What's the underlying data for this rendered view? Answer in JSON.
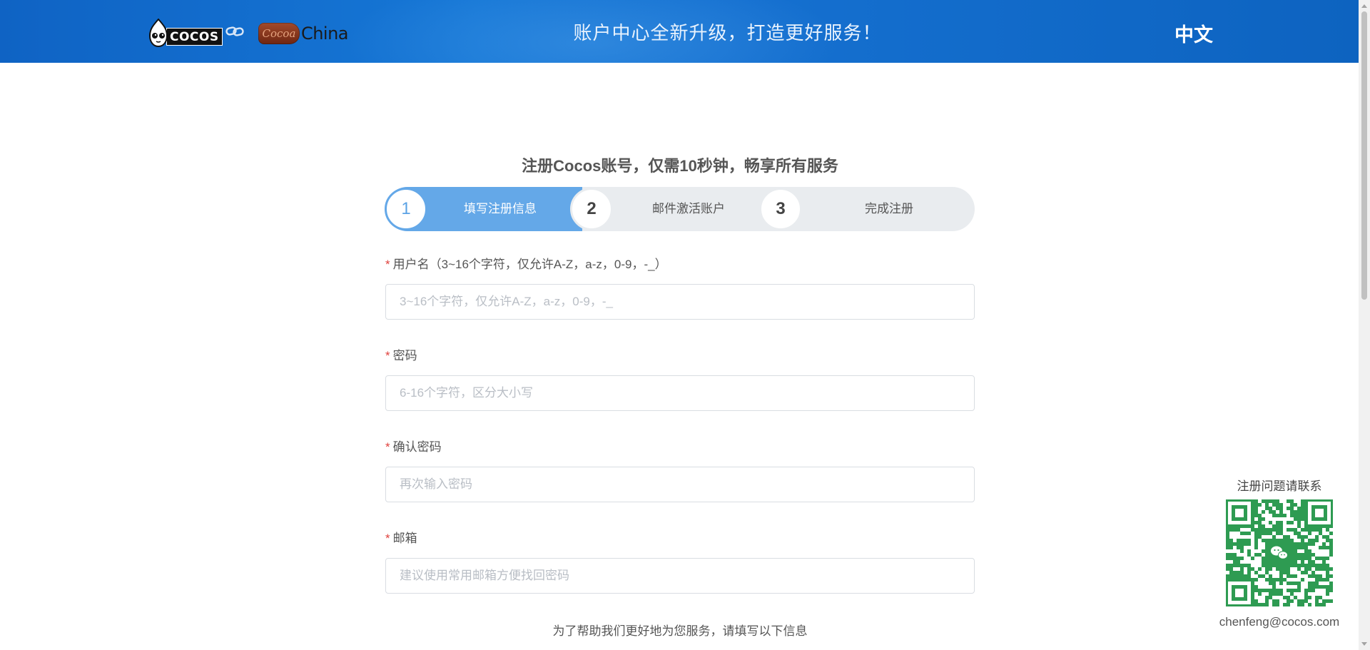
{
  "header": {
    "logo_cocos_text": "COCOS",
    "logo_cocoa_badge": "Cocoa",
    "logo_china_text": "China",
    "slogan": "账户中心全新升级，打造更好服务！",
    "language": "中文"
  },
  "page": {
    "title": "注册Cocos账号，仅需10秒钟，畅享所有服务"
  },
  "steps": [
    {
      "number": "1",
      "label": "填写注册信息",
      "active": true
    },
    {
      "number": "2",
      "label": "邮件激活账户",
      "active": false
    },
    {
      "number": "3",
      "label": "完成注册",
      "active": false
    }
  ],
  "form": {
    "required_mark": "*",
    "username": {
      "label": "用户名（3~16个字符，仅允许A-Z，a-z，0-9，-_）",
      "placeholder": "3~16个字符，仅允许A-Z，a-z，0-9，-_",
      "value": ""
    },
    "password": {
      "label": "密码",
      "placeholder": "6-16个字符，区分大小写",
      "value": ""
    },
    "confirm_password": {
      "label": "确认密码",
      "placeholder": "再次输入密码",
      "value": ""
    },
    "email": {
      "label": "邮箱",
      "placeholder": "建议使用常用邮箱方便找回密码",
      "value": ""
    },
    "help_text": "为了帮助我们更好地为您服务，请填写以下信息"
  },
  "contact": {
    "title": "注册问题请联系",
    "email": "chenfeng@cocos.com"
  },
  "colors": {
    "header_blue": "#1570d0",
    "step_active": "#64a8e8",
    "step_inactive": "#e9ecef",
    "required_red": "#e0423e",
    "qr_green": "#2e9b52"
  },
  "icons": {
    "link": "link-icon",
    "wechat": "wechat-icon",
    "mascot": "cocos-mascot-icon"
  }
}
